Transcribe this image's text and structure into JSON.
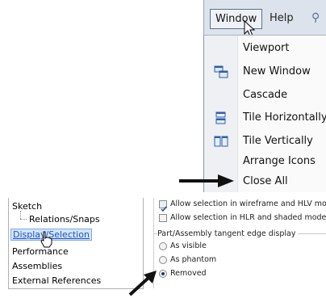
{
  "menubar": {
    "window_label": "Window",
    "help_label": "Help"
  },
  "window_menu": {
    "items": [
      {
        "label": "Viewport",
        "icon": ""
      },
      {
        "label": "New Window",
        "icon": "new-window-icon"
      },
      {
        "label": "Cascade",
        "icon": ""
      },
      {
        "label": "Tile Horizontally",
        "icon": "tile-horizontally-icon"
      },
      {
        "label": "Tile Vertically",
        "icon": "tile-vertically-icon"
      },
      {
        "label": "Arrange Icons",
        "icon": ""
      },
      {
        "label": "Close All",
        "icon": ""
      }
    ]
  },
  "tree": {
    "items": [
      "Sketch",
      "Relations/Snaps",
      "Display/Selection",
      "Performance",
      "Assemblies",
      "External References"
    ],
    "selected": "Display/Selection"
  },
  "options": {
    "checkbox1": "Allow selection in wireframe and HLV mod",
    "checkbox2": "Allow selection in HLR and shaded modes",
    "group_title": "Part/Assembly tangent edge display",
    "radio1": "As visible",
    "radio2": "As phantom",
    "radio3": "Removed",
    "selected_radio": "Removed"
  },
  "colors": {
    "accent": "#2451b8",
    "menubar": "#dde3ec"
  }
}
